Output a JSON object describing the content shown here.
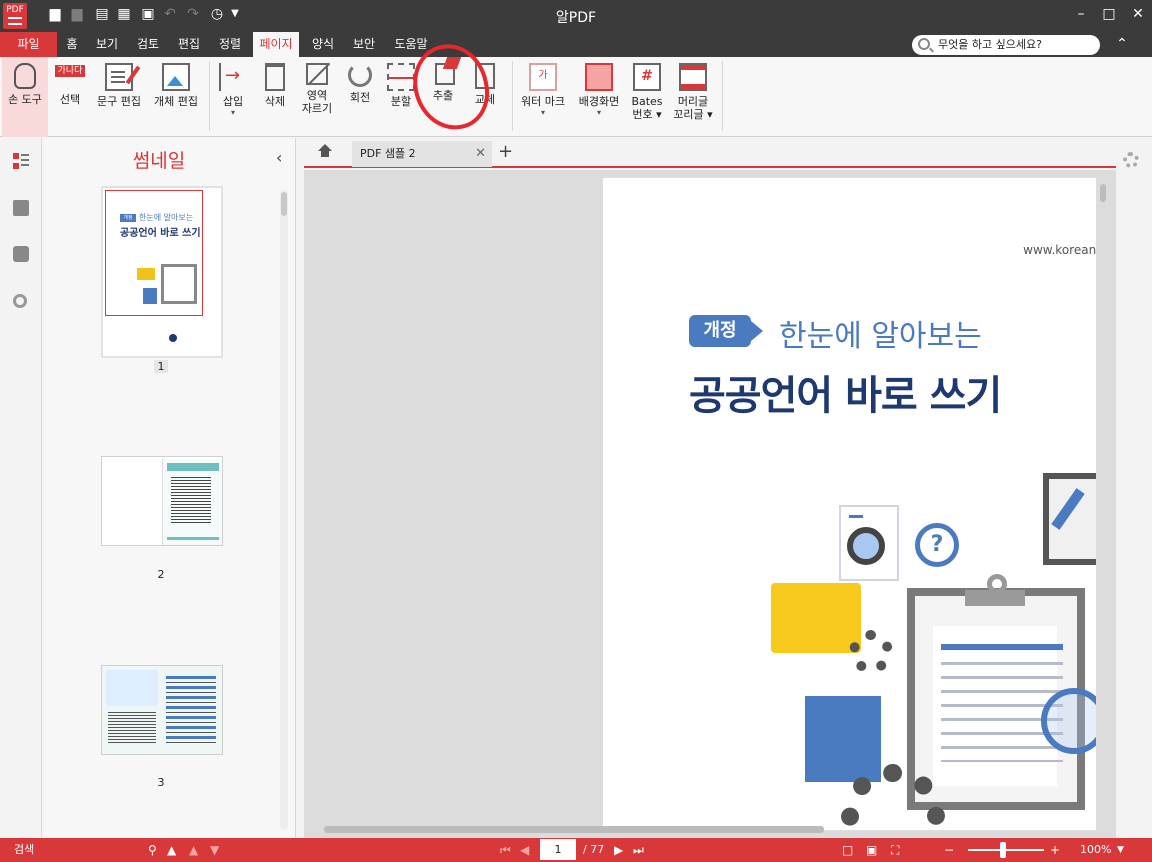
{
  "app": {
    "title": "알PDF",
    "logo_text": "PDF"
  },
  "quick_access": [
    "open-folder-icon",
    "save-icon",
    "scan-icon",
    "print-icon",
    "print-preview-icon",
    "undo-icon",
    "redo-icon",
    "recent-icon"
  ],
  "menu": {
    "file": "파일",
    "items": [
      "홈",
      "보기",
      "검토",
      "편집",
      "정렬",
      "페이지",
      "양식",
      "보안",
      "도움말"
    ],
    "active_index": 5
  },
  "search": {
    "placeholder": "무엇을 하고 싶으세요?"
  },
  "ribbon": {
    "hand": "손 도구",
    "select": "선택",
    "select_badge": "가나다",
    "text_edit": "문구 편집",
    "object_edit": "개체 편집",
    "insert": "삽입",
    "delete": "삭제",
    "crop_1": "영역",
    "crop_2": "자르기",
    "rotate": "회전",
    "split": "분할",
    "extract": "추출",
    "replace": "교체",
    "watermark": "워터 마크",
    "watermark_glyph": "가",
    "background": "배경화면",
    "bates_1": "Bates",
    "bates_2": "번호",
    "bates_glyph": "#",
    "header_1": "머리글",
    "header_2": "꼬리글",
    "dropdown_glyph": "▾"
  },
  "thumbnails": {
    "title": "썸네일",
    "pages": [
      {
        "num": "1",
        "badge": "개정",
        "sub": "한눈에 알아보는",
        "main": "공공언어 바로 쓰기"
      },
      {
        "num": "2"
      },
      {
        "num": "3"
      }
    ]
  },
  "tabs": {
    "doc_title": "PDF 샘플 2"
  },
  "document": {
    "url": "www.korean.",
    "badge": "개정",
    "subtitle": "한눈에 알아보는",
    "title": "공공언어 바로 쓰기",
    "question_glyph": "?"
  },
  "status": {
    "search_label": "검색",
    "current_page": "1",
    "total_pages": "/ 77",
    "zoom": "100%"
  },
  "colors": {
    "accent": "#d9383a",
    "titlebar": "#3b3b3b",
    "doc_blue": "#4a7ac0",
    "doc_navy": "#1e3870"
  }
}
